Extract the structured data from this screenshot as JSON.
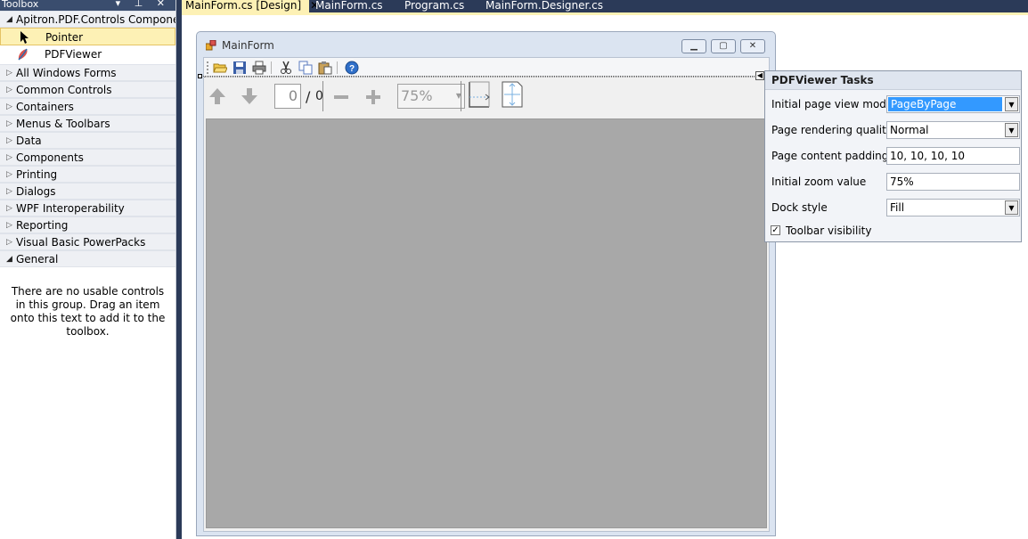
{
  "toolbox": {
    "title": "Toolbox",
    "controls": "▾ ⊥ ✕",
    "active_group": "Apitron.PDF.Controls Compone...",
    "items": [
      {
        "label": "Pointer"
      },
      {
        "label": "PDFViewer"
      }
    ],
    "groups": [
      {
        "label": "All Windows Forms"
      },
      {
        "label": "Common Controls"
      },
      {
        "label": "Containers"
      },
      {
        "label": "Menus & Toolbars"
      },
      {
        "label": "Data"
      },
      {
        "label": "Components"
      },
      {
        "label": "Printing"
      },
      {
        "label": "Dialogs"
      },
      {
        "label": "WPF Interoperability"
      },
      {
        "label": "Reporting"
      },
      {
        "label": "Visual Basic PowerPacks"
      },
      {
        "label": "General"
      }
    ],
    "empty_message": "There are no usable controls in this group. Drag an item onto this text to add it to the toolbox."
  },
  "tabs": [
    {
      "label": "MainForm.cs [Design]",
      "close": "✕"
    },
    {
      "label": "MainForm.cs"
    },
    {
      "label": "Program.cs"
    },
    {
      "label": "MainForm.Designer.cs"
    }
  ],
  "form": {
    "title": "MainForm"
  },
  "pdf_toolbar": {
    "page_value": "0",
    "page_separator": "/",
    "page_total": "0",
    "zoom_value": "75%"
  },
  "tasks_panel": {
    "title": "PDFViewer Tasks",
    "rows": [
      {
        "label": "Initial page view mode",
        "value": "PageByPage"
      },
      {
        "label": "Page rendering quality",
        "value": "Normal"
      },
      {
        "label": "Page content padding",
        "value": "10, 10, 10, 10"
      },
      {
        "label": "Initial zoom value",
        "value": "75%"
      },
      {
        "label": "Dock style",
        "value": "Fill"
      }
    ],
    "toolbar_visibility_label": "Toolbar visibility",
    "toolbar_visibility_checked": true
  },
  "colors": {
    "tab_strip": "#2b3a58",
    "active_tab": "#fdf1b5",
    "selection_highlight": "#3399ff",
    "viewer_background": "#a8a8a8"
  }
}
